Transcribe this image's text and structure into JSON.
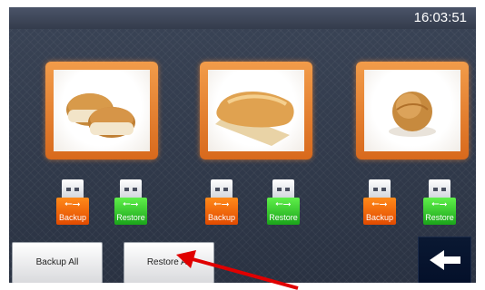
{
  "status_bar": {
    "time": "16:03:51"
  },
  "items": [
    {
      "image": "bread-rolls-image",
      "backup_label": "Backup",
      "restore_label": "Restore"
    },
    {
      "image": "baguette-image",
      "backup_label": "Backup",
      "restore_label": "Restore"
    },
    {
      "image": "round-roll-image",
      "backup_label": "Backup",
      "restore_label": "Restore"
    }
  ],
  "actions": {
    "backup_all_label": "Backup All",
    "restore_all_label": "Restore All",
    "back_icon": "arrow-left-icon"
  },
  "colors": {
    "card_orange": "#e07a2a",
    "backup_orange": "#ff6a00",
    "restore_green": "#2fbf2a",
    "annotation_red": "#e00000"
  }
}
